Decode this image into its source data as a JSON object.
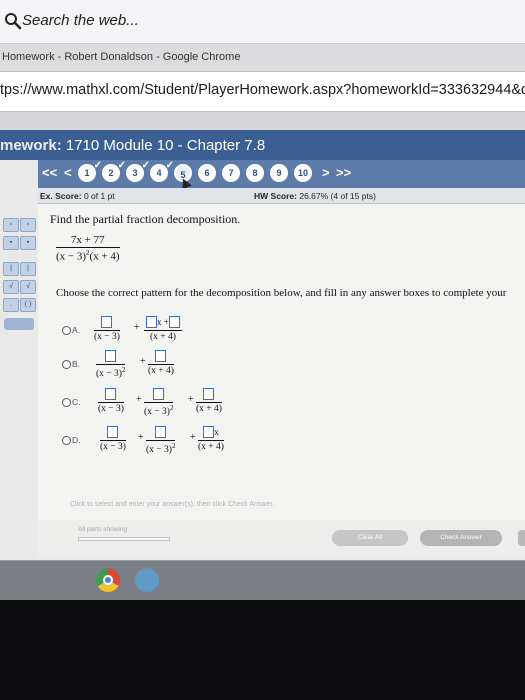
{
  "taskbar_search": {
    "placeholder": "Search the web..."
  },
  "window": {
    "title": "Homework - Robert Donaldson - Google Chrome"
  },
  "browser": {
    "url": "tps://www.mathxl.com/Student/PlayerHomework.aspx?homeworkId=333632944&questio"
  },
  "assignment": {
    "prefix": "mework:",
    "title": "1710 Module 10 - Chapter 7.8"
  },
  "question_nav": {
    "prev_all": "<<",
    "prev": "<",
    "next": ">",
    "next_all": ">>",
    "questions": [
      "1",
      "2",
      "3",
      "4",
      "5",
      "6",
      "7",
      "8",
      "9",
      "10"
    ],
    "completed": [
      "1",
      "2",
      "3",
      "4"
    ],
    "current": "5"
  },
  "score": {
    "ex_label": "Ex. Score:",
    "ex_value": "0 of 1 pt",
    "hw_label": "HW Score:",
    "hw_value": "26.67% (4 of 15 pts)"
  },
  "problem": {
    "prompt": "Find the partial fraction decomposition.",
    "numerator": "7x + 77",
    "denominator": "(x − 3)",
    "denominator_exp": "2",
    "denominator_tail": "(x + 4)",
    "instruction": "Choose the correct pattern for the decomposition below, and fill in any answer boxes to complete your"
  },
  "options": {
    "a": {
      "label": "A.",
      "d1": "(x − 3)",
      "n2": "x +",
      "d2": "(x + 4)"
    },
    "b": {
      "label": "B.",
      "d1": "(x − 3)",
      "d1_exp": "2",
      "d2": "(x + 4)"
    },
    "c": {
      "label": "C.",
      "d1": "(x − 3)",
      "d2": "(x − 3)",
      "d2_exp": "2",
      "d3": "(x + 4)"
    },
    "d": {
      "label": "D.",
      "d1": "(x − 3)",
      "d2": "(x − 3)",
      "d2_exp": "2",
      "n3": "x",
      "d3": "(x + 4)"
    }
  },
  "hint": "Click to select and enter your answer(s), then click Check Answer.",
  "controls": {
    "parts_label": "All parts showing",
    "parts_fraction": 0,
    "clear_all": "Clear All",
    "check_answer": "Check Answer"
  },
  "colors": {
    "header": "#3b5f92",
    "nav": "#5c7ba8",
    "answer_box_border": "#3d6fb6"
  }
}
